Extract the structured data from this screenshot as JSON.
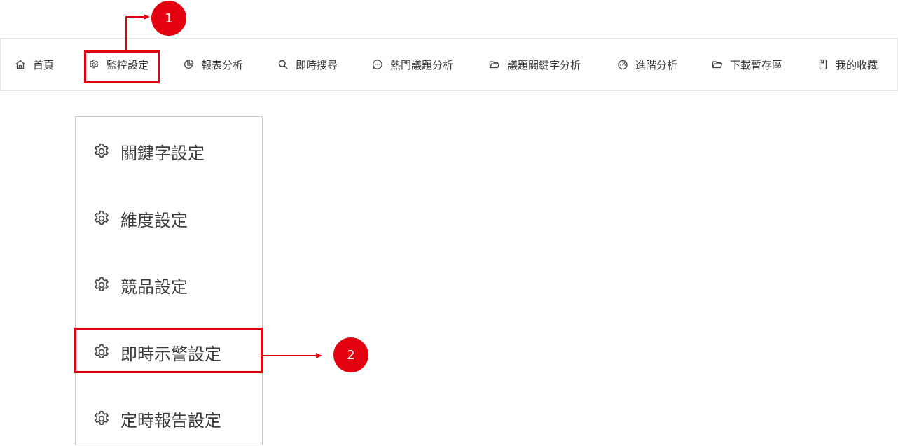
{
  "nav": {
    "items": [
      {
        "label": "首頁",
        "icon": "home-icon"
      },
      {
        "label": "監控設定",
        "icon": "gear-icon"
      },
      {
        "label": "報表分析",
        "icon": "pie-chart-icon"
      },
      {
        "label": "即時搜尋",
        "icon": "search-icon"
      },
      {
        "label": "熱門議題分析",
        "icon": "chat-bubble-icon"
      },
      {
        "label": "議題關鍵字分析",
        "icon": "folder-open-icon"
      },
      {
        "label": "進階分析",
        "icon": "gauge-icon"
      },
      {
        "label": "下載暫存區",
        "icon": "folder-open-icon"
      },
      {
        "label": "我的收藏",
        "icon": "bookmark-icon"
      }
    ]
  },
  "dropdown": {
    "items": [
      {
        "label": "關鍵字設定",
        "icon": "gear-icon"
      },
      {
        "label": "維度設定",
        "icon": "gear-icon"
      },
      {
        "label": "競品設定",
        "icon": "gear-icon"
      },
      {
        "label": "即時示警設定",
        "icon": "gear-icon"
      },
      {
        "label": "定時報告設定",
        "icon": "gear-icon"
      }
    ]
  },
  "annotations": {
    "step1": "1",
    "step2": "2"
  },
  "colors": {
    "annotation_red": "#e3000f",
    "text": "#333333",
    "border": "#e6e6e6"
  }
}
